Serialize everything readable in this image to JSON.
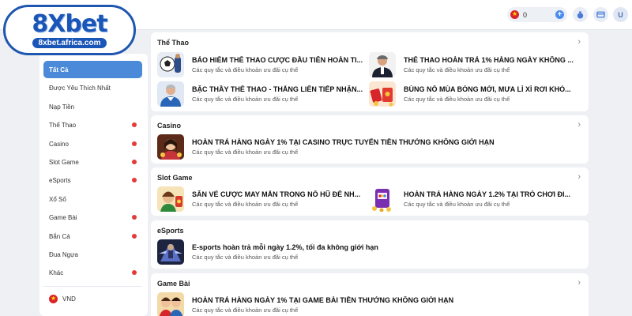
{
  "logo": {
    "main": "8Xbet",
    "sub": "8xbet.africa.com"
  },
  "header": {
    "balance": "0",
    "avatar_letter": "U"
  },
  "sidebar": {
    "items": [
      {
        "label": "Tất Cả",
        "active": true,
        "badge": false
      },
      {
        "label": "Được Yêu Thích Nhất",
        "active": false,
        "badge": false
      },
      {
        "label": "Nạp Tiền",
        "active": false,
        "badge": false
      },
      {
        "label": "Thể Thao",
        "active": false,
        "badge": true
      },
      {
        "label": "Casino",
        "active": false,
        "badge": true
      },
      {
        "label": "Slot Game",
        "active": false,
        "badge": true
      },
      {
        "label": "eSports",
        "active": false,
        "badge": true
      },
      {
        "label": "Xổ Số",
        "active": false,
        "badge": false
      },
      {
        "label": "Game Bài",
        "active": false,
        "badge": true
      },
      {
        "label": "Bắn Cá",
        "active": false,
        "badge": true
      },
      {
        "label": "Đua Ngựa",
        "active": false,
        "badge": false
      },
      {
        "label": "Khác",
        "active": false,
        "badge": true
      }
    ],
    "currency": "VND"
  },
  "sections": [
    {
      "title": "Thể Thao",
      "promos": [
        {
          "title": "BẢO HIỂM THỂ THAO CƯỢC ĐẦU TIÊN HOÀN TI...",
          "sub": "Các quy tắc và điều khoản ưu đãi cụ thể",
          "icon": "soccer-player-thumbnail"
        },
        {
          "title": "THỂ THAO HOÀN TRẢ 1% HÀNG NGÀY KHÔNG ...",
          "sub": "Các quy tắc và điều khoản ưu đãi cụ thể",
          "icon": "coach-thumbnail"
        },
        {
          "title": "BẬC THẦY THỂ THAO - THẮNG LIÊN TIẾP NHẬN...",
          "sub": "Các quy tắc và điều khoản ưu đãi cụ thể",
          "icon": "manager-thumbnail"
        },
        {
          "title": "BÙNG NỔ MÙA BÓNG MỚI, MƯA LÌ XÌ RƠI KHỎ...",
          "sub": "Các quy tắc và điều khoản ưu đãi cụ thể",
          "icon": "lucky-money-thumbnail"
        }
      ]
    },
    {
      "title": "Casino",
      "promos": [
        {
          "title": "HOÀN TRẢ HÀNG NGÀY 1% TẠI CASINO TRỰC TUYẾN TIỀN THƯỞNG KHÔNG GIỚI HẠN",
          "sub": "Các quy tắc và điều khoản ưu đãi cụ thể",
          "icon": "casino-dealer-thumbnail"
        }
      ]
    },
    {
      "title": "Slot Game",
      "promos": [
        {
          "title": "SĂN VÉ CƯỢC MAY MẮN TRONG NỔ HŨ ĐỂ NH...",
          "sub": "Các quy tắc và điều khoản ưu đãi cụ thể",
          "icon": "slot-character-thumbnail"
        },
        {
          "title": "HOÀN TRẢ HÀNG NGÀY 1.2% TẠI TRÒ CHƠI ĐI...",
          "sub": "Các quy tắc và điều khoản ưu đãi cụ thể",
          "icon": "slot-machine-thumbnail"
        }
      ]
    },
    {
      "title": "eSports",
      "promos": [
        {
          "title": "E-sports hoàn trả mỗi ngày 1.2%, tối đa không giới hạn",
          "sub": "Các quy tắc và điều khoản ưu đãi cụ thể",
          "icon": "esports-hero-thumbnail"
        }
      ]
    },
    {
      "title": "Game Bài",
      "promos": [
        {
          "title": "HOÀN TRẢ HÀNG NGÀY 1% TẠI GAME BÀI TIỀN THƯỞNG KHÔNG GIỚI HẠN",
          "sub": "Các quy tắc và điều khoản ưu đãi cụ thể",
          "icon": "card-game-thumbnail"
        }
      ]
    }
  ]
}
